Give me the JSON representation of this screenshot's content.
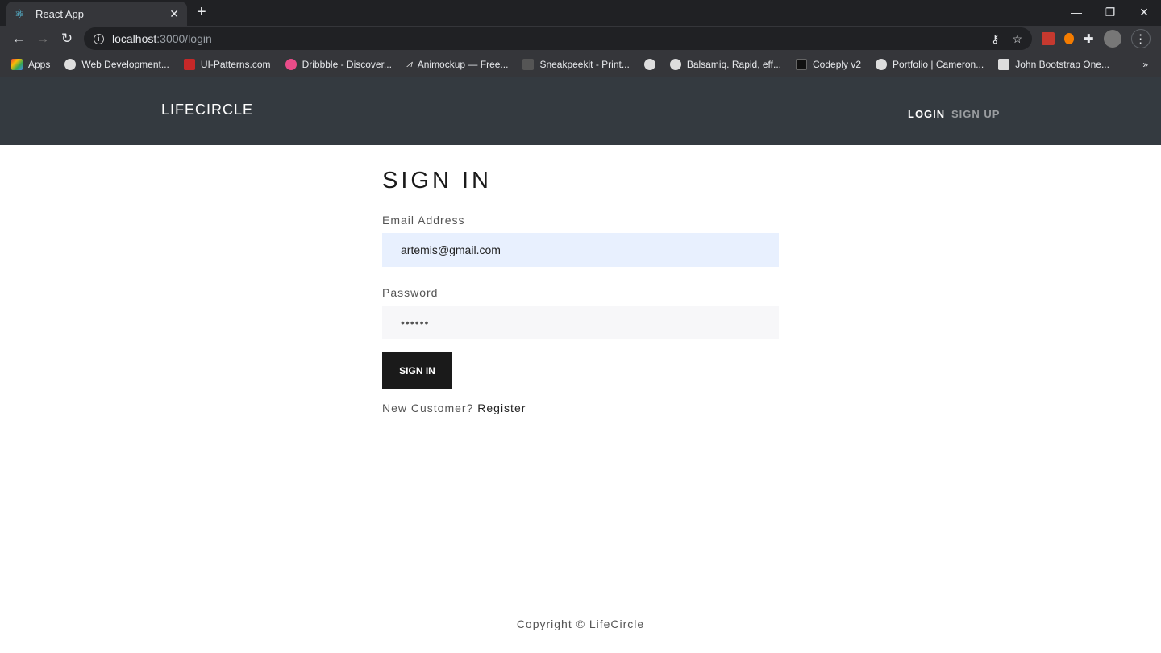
{
  "browser": {
    "tab_title": "React App",
    "url_host": "localhost",
    "url_path": ":3000/login",
    "bookmarks": [
      "Apps",
      "Web Development...",
      "UI-Patterns.com",
      "Dribbble - Discover...",
      "Animockup — Free...",
      "Sneakpeekit - Print...",
      "",
      "Balsamiq. Rapid, eff...",
      "Codeply v2",
      "Portfolio | Cameron...",
      "John Bootstrap One..."
    ]
  },
  "navbar": {
    "brand": "LIFECIRCLE",
    "login": "LOGIN",
    "signup": "SIGN UP"
  },
  "form": {
    "title": "SIGN IN",
    "email_label": "Email Address",
    "email_value": "artemis@gmail.com",
    "password_label": "Password",
    "password_value": "••••••",
    "submit": "SIGN IN",
    "new_customer": "New Customer?",
    "register": "Register"
  },
  "footer": {
    "copyright": "Copyright © LifeCircle"
  },
  "colors": {
    "header_bg": "#343a40",
    "email_bg": "#e8f0fe",
    "password_bg": "#f7f7f9",
    "button_bg": "#1a1a1a"
  }
}
